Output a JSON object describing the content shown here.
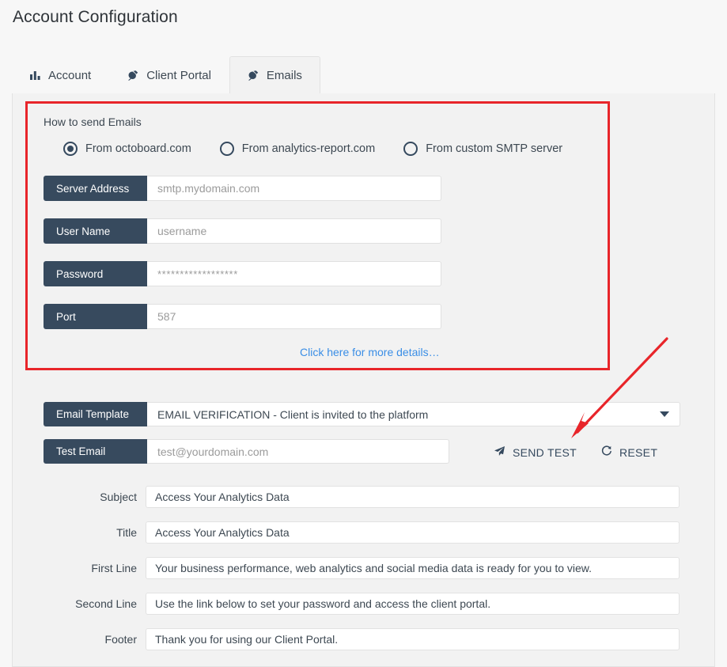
{
  "page": {
    "title": "Account Configuration"
  },
  "tabs": [
    {
      "label": "Account",
      "icon": "bar-chart-icon",
      "active": false
    },
    {
      "label": "Client Portal",
      "icon": "plug-icon",
      "active": false
    },
    {
      "label": "Emails",
      "icon": "plug-icon",
      "active": true
    }
  ],
  "smtp_section": {
    "heading": "How to send Emails",
    "radios": [
      {
        "label": "From octoboard.com",
        "selected": true
      },
      {
        "label": "From analytics-report.com",
        "selected": false
      },
      {
        "label": "From custom SMTP server",
        "selected": false
      }
    ],
    "fields": [
      {
        "label": "Server Address",
        "value": "smtp.mydomain.com"
      },
      {
        "label": "User Name",
        "value": "username"
      },
      {
        "label": "Password",
        "value": "******************"
      },
      {
        "label": "Port",
        "value": "587"
      }
    ],
    "more_details_link": "Click here for more details…",
    "highlight_color": "#e8252a"
  },
  "template_section": {
    "template_label": "Email Template",
    "template_value": "EMAIL VERIFICATION - Client is invited to the platform",
    "test_email_label": "Test Email",
    "test_email_placeholder": "test@yourdomain.com",
    "send_test_label": "SEND TEST",
    "reset_label": "RESET"
  },
  "message_fields": [
    {
      "label": "Subject",
      "value": "Access Your Analytics Data"
    },
    {
      "label": "Title",
      "value": "Access Your Analytics Data"
    },
    {
      "label": "First Line",
      "value": "Your business performance, web analytics and social media data is ready for you to view."
    },
    {
      "label": "Second Line",
      "value": "Use the link below to set your password and access the client portal."
    },
    {
      "label": "Footer",
      "value": "Thank you for using our Client Portal."
    }
  ],
  "annotation": {
    "arrow_color": "#e8252a",
    "arrow_points_to": "SEND TEST"
  }
}
